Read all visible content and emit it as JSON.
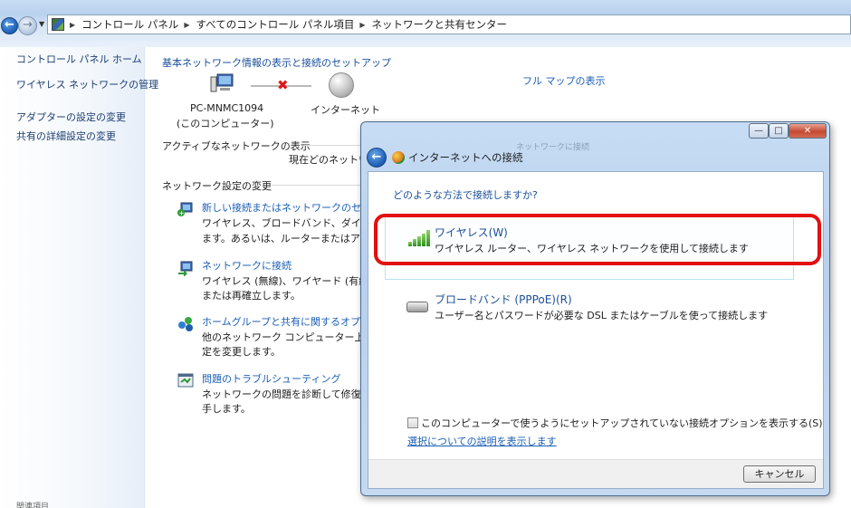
{
  "address_bar": {
    "breadcrumbs": [
      "コントロール パネル",
      "すべてのコントロール パネル項目",
      "ネットワークと共有センター"
    ]
  },
  "sidebar": {
    "links": [
      "コントロール パネル ホーム",
      "ワイヤレス ネットワークの管理",
      "アダプターの設定の変更",
      "共有の詳細設定の変更"
    ],
    "bottom_text": "関連項目"
  },
  "main": {
    "heading": "基本ネットワーク情報の表示と接続のセットアップ",
    "full_map_link": "フル マップの表示",
    "pc_name": "PC-MNMC1094",
    "pc_sub": "(このコンピューター)",
    "internet_label": "インターネット",
    "active_title": "アクティブなネットワークの表示",
    "current_text": "現在どのネットワ",
    "change_title": "ネットワーク設定の変更",
    "tasks": [
      {
        "link": "新しい接続またはネットワークのセッ",
        "desc": [
          "ワイヤレス、ブロードバンド、ダイヤル",
          "ます。あるいは、ルーターまたはアク"
        ]
      },
      {
        "link": "ネットワークに接続",
        "desc": [
          "ワイヤレス (無線)、ワイヤード (有線)",
          "または再確立します。"
        ]
      },
      {
        "link": "ホームグループと共有に関するオプショ",
        "desc": [
          "他のネットワーク コンピューター上に",
          "定を変更します。"
        ]
      },
      {
        "link": "問題のトラブルシューティング",
        "desc": [
          "ネットワークの問題を診断して修復し",
          "手します。"
        ]
      }
    ]
  },
  "dialog": {
    "faint_title": "ネットワークに接続",
    "title": "インターネットへの接続",
    "question": "どのような方法で接続しますか?",
    "options": [
      {
        "title": "ワイヤレス(W)",
        "desc": "ワイヤレス ルーター、ワイヤレス ネットワークを使用して接続します"
      },
      {
        "title": "ブロードバンド (PPPoE)(R)",
        "desc": "ユーザー名とパスワードが必要な DSL またはケーブルを使って接続します"
      }
    ],
    "checkbox_label": "このコンピューターで使うようにセットアップされていない接続オプションを表示する(S)",
    "checkbox_checked": false,
    "help_link": "選択についての説明を表示します",
    "cancel_label": "キャンセル",
    "highlight_color": "#e21010"
  }
}
